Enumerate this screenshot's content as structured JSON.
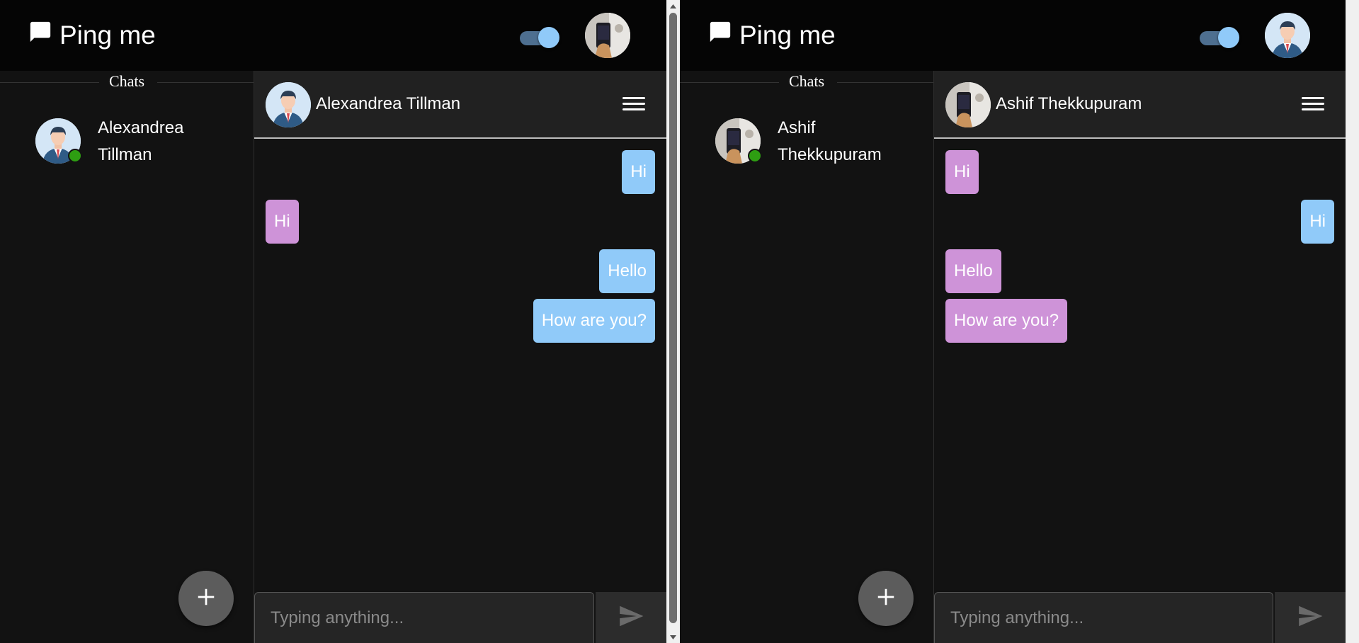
{
  "panes": [
    {
      "appbar": {
        "title": "Ping me",
        "icon": "chat-bubble-icon",
        "dark_mode_on": true,
        "user_avatar": "photo-avatar"
      },
      "sidebar": {
        "heading": "Chats",
        "items": [
          {
            "name_line1": "Alexandrea",
            "name_line2": "Tillman",
            "avatar": "businessman-avatar",
            "status": "online"
          }
        ],
        "fab_icon": "plus-icon"
      },
      "chat": {
        "title": "Alexandrea Tillman",
        "avatar": "businessman-avatar",
        "messages": [
          {
            "text": "Hi",
            "direction": "sent"
          },
          {
            "text": "Hi",
            "direction": "received"
          },
          {
            "text": "Hello",
            "direction": "sent"
          },
          {
            "text": "How are you?",
            "direction": "sent"
          }
        ],
        "composer": {
          "placeholder": "Typing anything...",
          "send_icon": "send-icon"
        }
      }
    },
    {
      "appbar": {
        "title": "Ping me",
        "icon": "chat-bubble-icon",
        "dark_mode_on": true,
        "user_avatar": "businessman-avatar"
      },
      "sidebar": {
        "heading": "Chats",
        "items": [
          {
            "name_line1": "Ashif",
            "name_line2": "Thekkupuram",
            "avatar": "photo-avatar",
            "status": "online"
          }
        ],
        "fab_icon": "plus-icon"
      },
      "chat": {
        "title": "Ashif Thekkupuram",
        "avatar": "photo-avatar",
        "messages": [
          {
            "text": "Hi",
            "direction": "received"
          },
          {
            "text": "Hi",
            "direction": "sent"
          },
          {
            "text": "Hello",
            "direction": "received"
          },
          {
            "text": "How are you?",
            "direction": "received"
          }
        ],
        "composer": {
          "placeholder": "Typing anything...",
          "send_icon": "send-icon"
        }
      }
    }
  ],
  "colors": {
    "sent_bubble": "#90caf9",
    "received_bubble": "#ce93d8",
    "background": "#121212",
    "appbar": "#050505",
    "online": "#2e9e12"
  }
}
